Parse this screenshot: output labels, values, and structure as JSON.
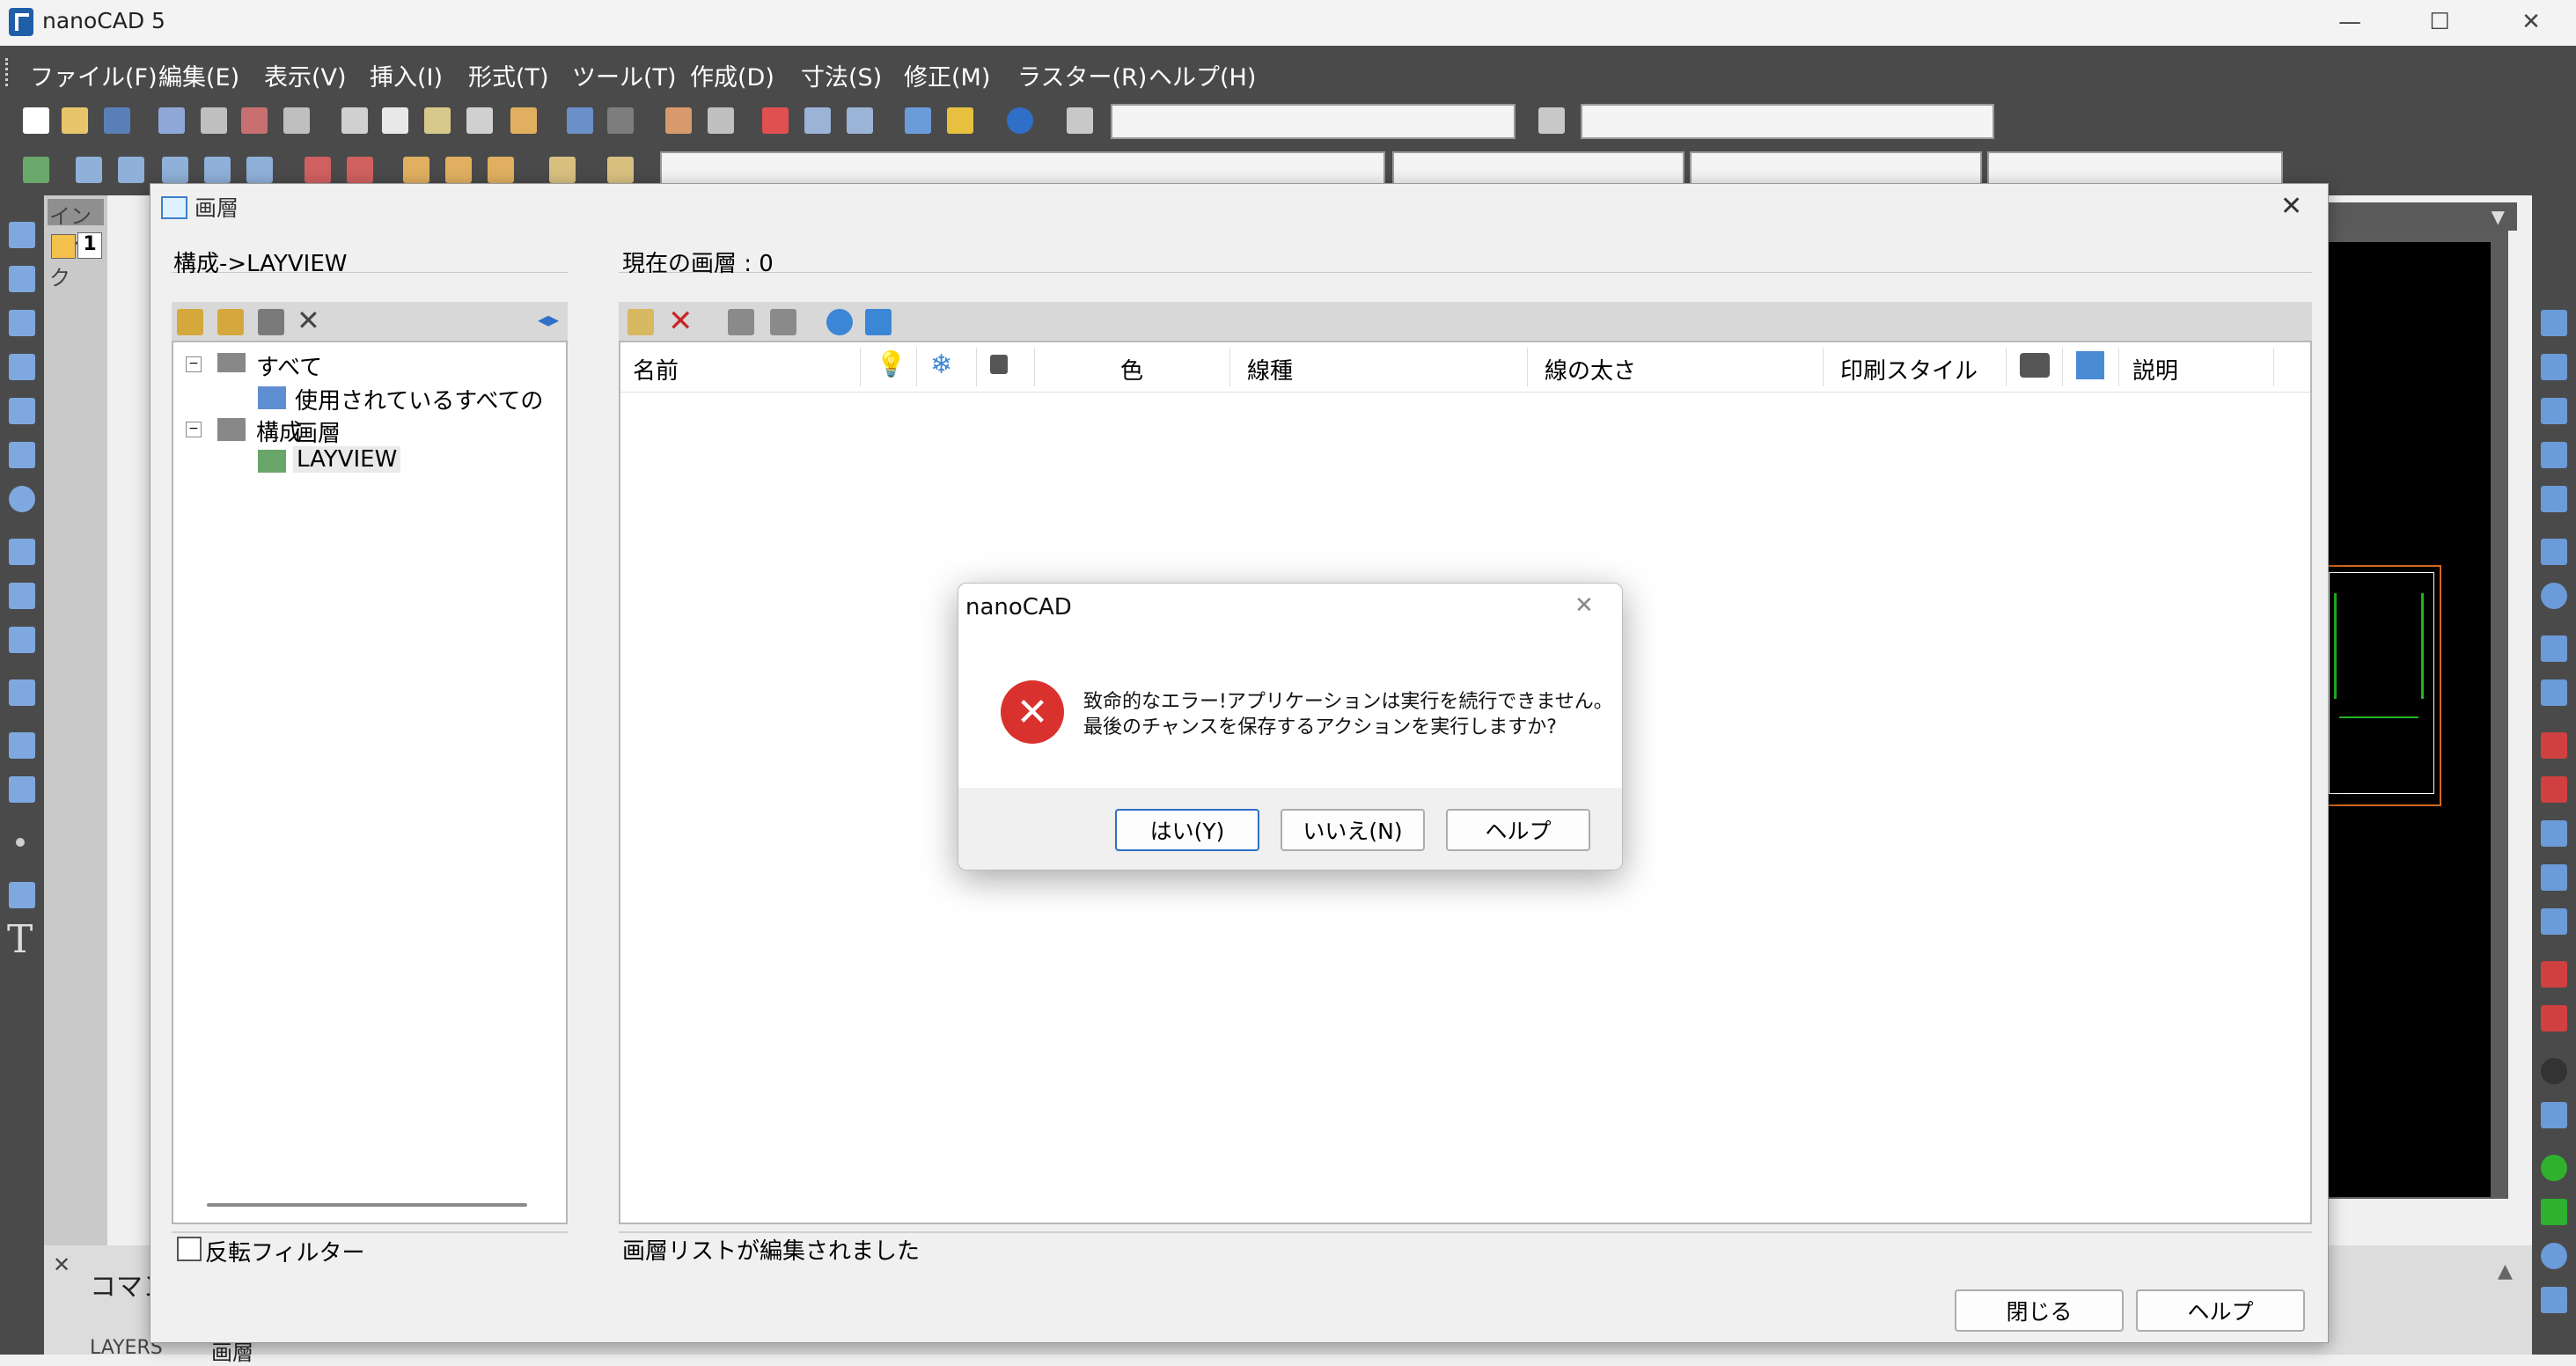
{
  "window": {
    "title": "nanoCAD 5",
    "minimize": "—",
    "maximize": "☐",
    "close": "✕"
  },
  "menu": [
    {
      "label": "ファイル(F)"
    },
    {
      "label": "編集(E)"
    },
    {
      "label": "表示(V)"
    },
    {
      "label": "挿入(I)"
    },
    {
      "label": "形式(T)"
    },
    {
      "label": "ツール(T)"
    },
    {
      "label": "作成(D)"
    },
    {
      "label": "寸法(S)"
    },
    {
      "label": "修正(M)"
    },
    {
      "label": "ラスター(R)"
    },
    {
      "label": "ヘルプ(H)"
    }
  ],
  "inspector": {
    "label": "インスペク",
    "index": "1"
  },
  "command_panel": {
    "label": "コマン",
    "layers_text": "LAYERS",
    "layer_word": "画層"
  },
  "layer_dialog": {
    "title": "画層",
    "close": "✕",
    "filter_path": "構成->LAYVIEW",
    "current_layer": "現在の画層 : 0",
    "tree": {
      "all": "すべて",
      "all_used": "使用されているすべての画層",
      "config": "構成",
      "layview": "LAYVIEW"
    },
    "columns": [
      "名前",
      "色",
      "線種",
      "線の太さ",
      "印刷スタイル",
      "説明"
    ],
    "invert_filter": "反転フィルター",
    "status": "画層リストが編集されました",
    "close_button": "閉じる",
    "help_button": "ヘルプ"
  },
  "error_dialog": {
    "title": "nanoCAD",
    "close": "✕",
    "icon": "✕",
    "message_line1": "致命的なエラー!アプリケーションは実行を続行できません。",
    "message_line2": "最後のチャンスを保存するアクションを実行しますか?",
    "yes": "はい(Y)",
    "no": "いいえ(N)",
    "help": "ヘルプ"
  }
}
